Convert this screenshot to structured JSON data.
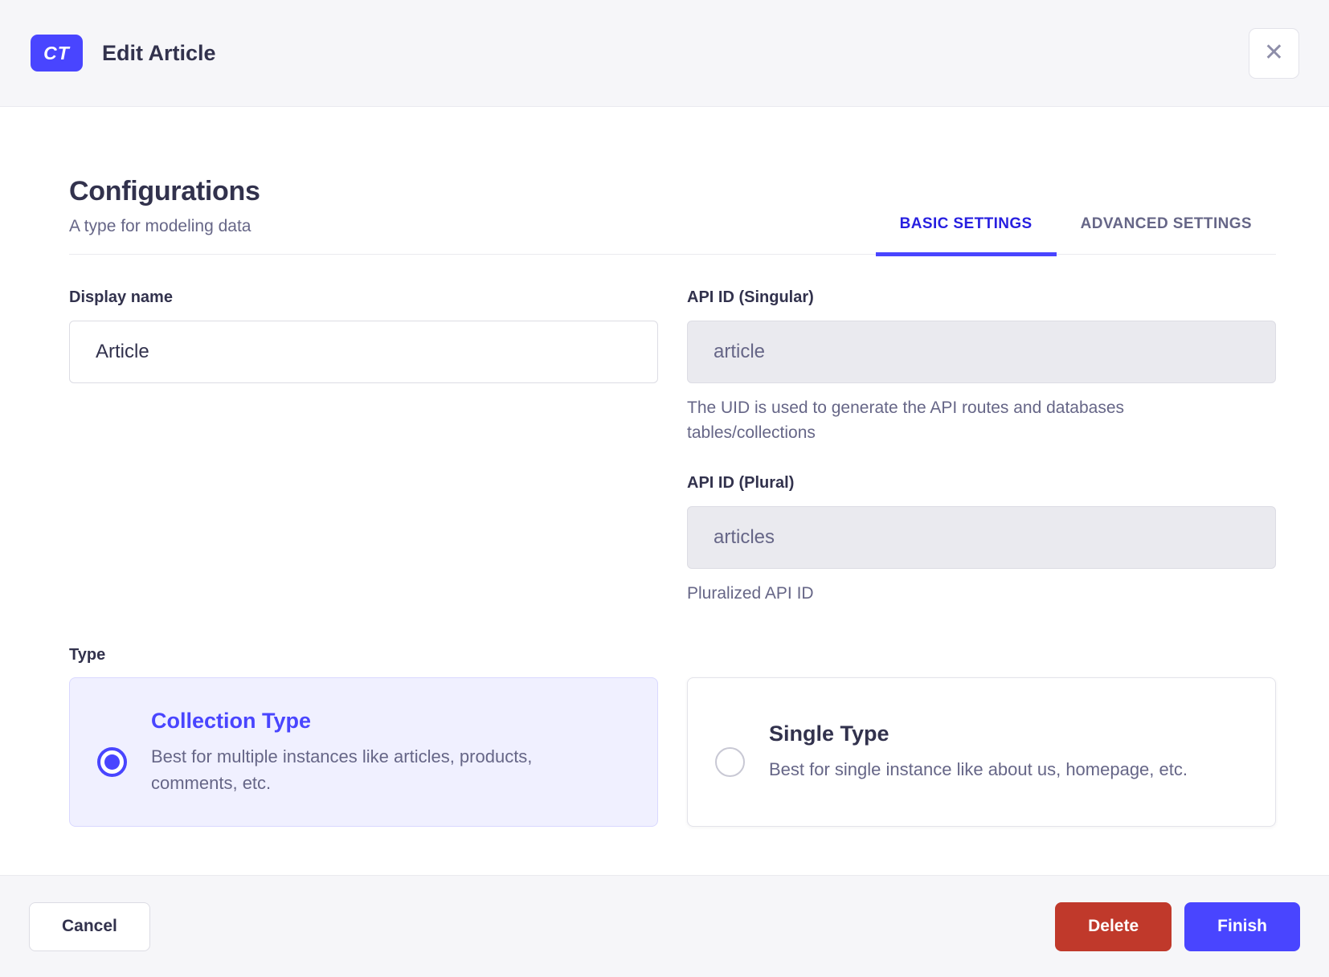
{
  "header": {
    "badge": "CT",
    "title": "Edit Article",
    "close_icon": "✕"
  },
  "section": {
    "title": "Configurations",
    "subtitle": "A type for modeling data",
    "tabs": [
      {
        "label": "BASIC SETTINGS",
        "active": true
      },
      {
        "label": "ADVANCED SETTINGS",
        "active": false
      }
    ]
  },
  "form": {
    "display_name": {
      "label": "Display name",
      "value": "Article"
    },
    "api_id_singular": {
      "label": "API ID (Singular)",
      "value": "article",
      "hint": "The UID is used to generate the API routes and databases tables/collections"
    },
    "api_id_plural": {
      "label": "API ID (Plural)",
      "value": "articles",
      "hint": "Pluralized API ID"
    },
    "type": {
      "label": "Type",
      "options": [
        {
          "title": "Collection Type",
          "description": "Best for multiple instances like articles, products, comments, etc.",
          "selected": true
        },
        {
          "title": "Single Type",
          "description": "Best for single instance like about us, homepage, etc.",
          "selected": false
        }
      ]
    }
  },
  "footer": {
    "cancel_label": "Cancel",
    "delete_label": "Delete",
    "finish_label": "Finish"
  },
  "colors": {
    "primary": "#4945ff",
    "primary_tab_text": "#271fe0",
    "selected_card_bg": "#f0f0ff",
    "selected_card_border": "#d9d8ff",
    "danger": "#c0392b",
    "surface": "#f6f6f9",
    "divider": "#eaeaef",
    "input_border": "#dcdce4",
    "disabled_bg": "#eaeaef",
    "text": "#32324d",
    "text_muted": "#666687",
    "close_icon": "#8e8ea9"
  }
}
